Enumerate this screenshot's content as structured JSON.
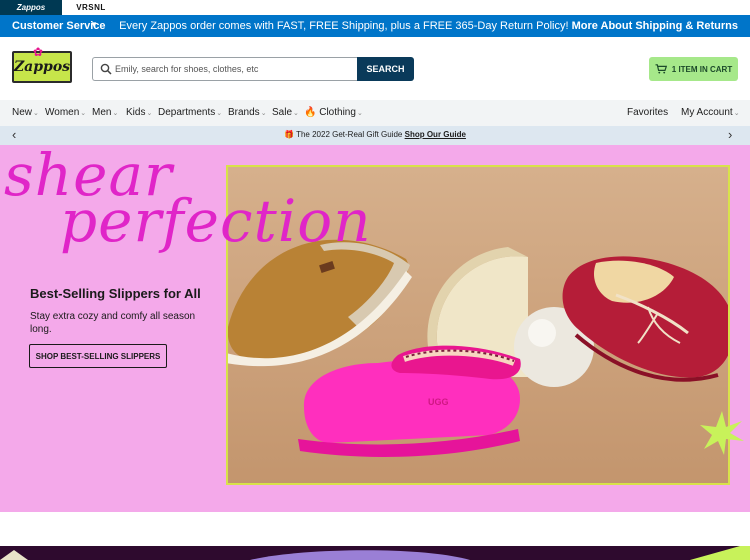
{
  "brands": {
    "zappos": "Zappos",
    "vrsnl": "VRSNL"
  },
  "service_bar": {
    "customer_service": "Customer Service",
    "promo_text": "Every Zappos order comes with FAST, FREE Shipping, plus a FREE 365-Day Return Policy!",
    "promo_link": "More About Shipping & Returns"
  },
  "header": {
    "logo_text": "Zappos",
    "search_placeholder": "Emily, search for shoes, clothes, etc",
    "search_button": "SEARCH",
    "cart_label": "1 ITEM IN CART"
  },
  "nav": {
    "items": [
      "New",
      "Women",
      "Men",
      "Kids",
      "Departments",
      "Brands",
      "Sale",
      "Clothing"
    ],
    "favorites": "Favorites",
    "my_account": "My Account"
  },
  "gift_bar": {
    "text": "The 2022 Get-Real Gift Guide",
    "link": "Shop Our Guide"
  },
  "hero": {
    "title_line1": "shear",
    "title_line2": "perfection",
    "heading": "Best-Selling Slippers for All",
    "subtext": "Stay extra cozy and comfy all season long.",
    "button": "SHOP BEST-SELLING SLIPPERS"
  },
  "colors": {
    "service_bar": "#0075c9",
    "hero_bg": "#f4a9ea",
    "hero_title": "#e025c8",
    "search_button": "#0a3a5a",
    "cart_bg": "#a6e88a"
  }
}
